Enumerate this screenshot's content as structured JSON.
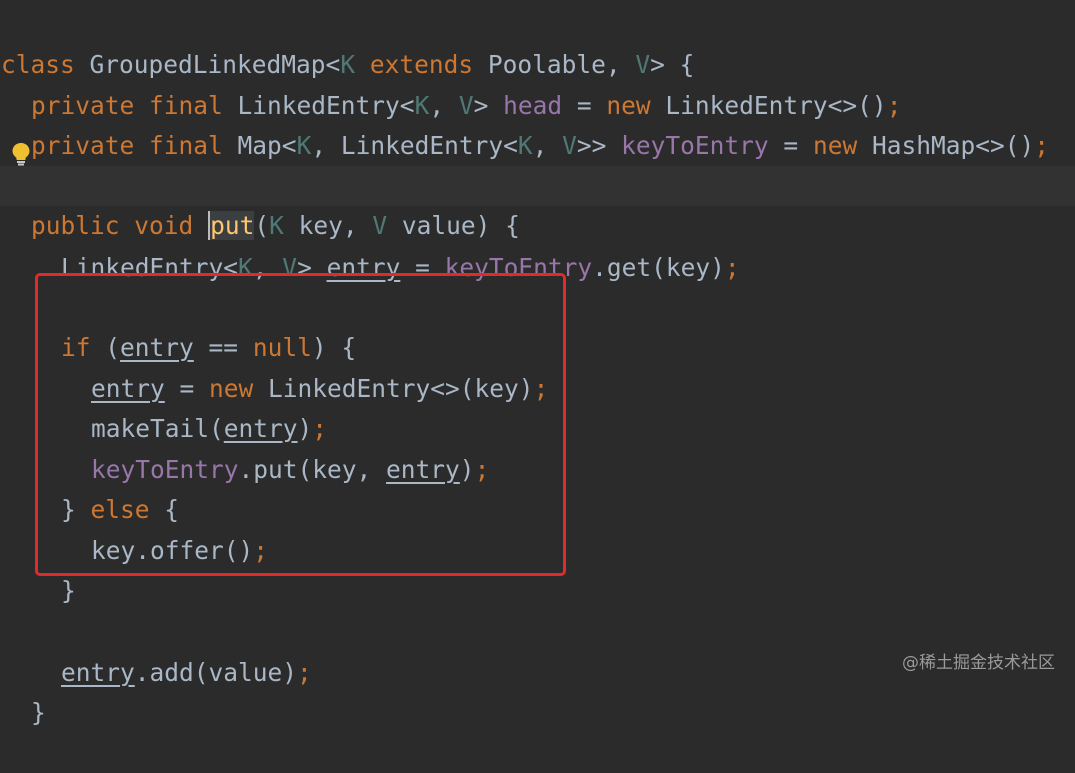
{
  "code_lines": [
    [
      "class",
      "GroupedLinkedMap",
      "<",
      "K",
      " ",
      "extends",
      " Poolable, ",
      "V",
      "> {"
    ],
    [
      "private",
      " ",
      "final",
      " LinkedEntry<",
      "K",
      ", ",
      "V",
      "> ",
      "head",
      " = ",
      "new",
      " LinkedEntry<>()",
      ";"
    ],
    [
      "private",
      " ",
      "final",
      " Map<",
      "K",
      ", LinkedEntry<",
      "K",
      ", ",
      "V",
      ">> ",
      "keyToEntry",
      " = ",
      "new",
      " HashMap<>()",
      ";"
    ],
    [],
    [
      "public",
      " ",
      "void",
      " ",
      "put",
      "(",
      "K",
      " key, ",
      "V",
      " value) {"
    ],
    [
      "LinkedEntry<",
      "K",
      ", ",
      "V",
      "> ",
      "entry",
      " = ",
      "keyToEntry",
      ".get(key)",
      ";"
    ],
    [],
    [
      "if",
      " (",
      "entry",
      " == ",
      "null",
      ") {"
    ],
    [
      "entry",
      " = ",
      "new",
      " LinkedEntry<>(key)",
      ";"
    ],
    [
      "makeTail(",
      "entry",
      ")",
      ";"
    ],
    [
      "keyToEntry",
      ".put(key, ",
      "entry",
      ")",
      ";"
    ],
    [
      "} ",
      "else",
      " {"
    ],
    [
      "key.offer()",
      ";"
    ],
    [
      "}"
    ],
    [],
    [
      "entry",
      ".add(value)",
      ";"
    ],
    [
      "}"
    ]
  ],
  "icons": {
    "intention_bulb": "lightbulb-icon"
  },
  "colors": {
    "background": "#2b2b2b",
    "keyword": "#cc7832",
    "text": "#a9b7c6",
    "type_param": "#507874",
    "field": "#9876aa",
    "method_decl": "#ffc66d",
    "highlight_box": "#e12a2a"
  },
  "watermark": "@稀土掘金技术社区"
}
